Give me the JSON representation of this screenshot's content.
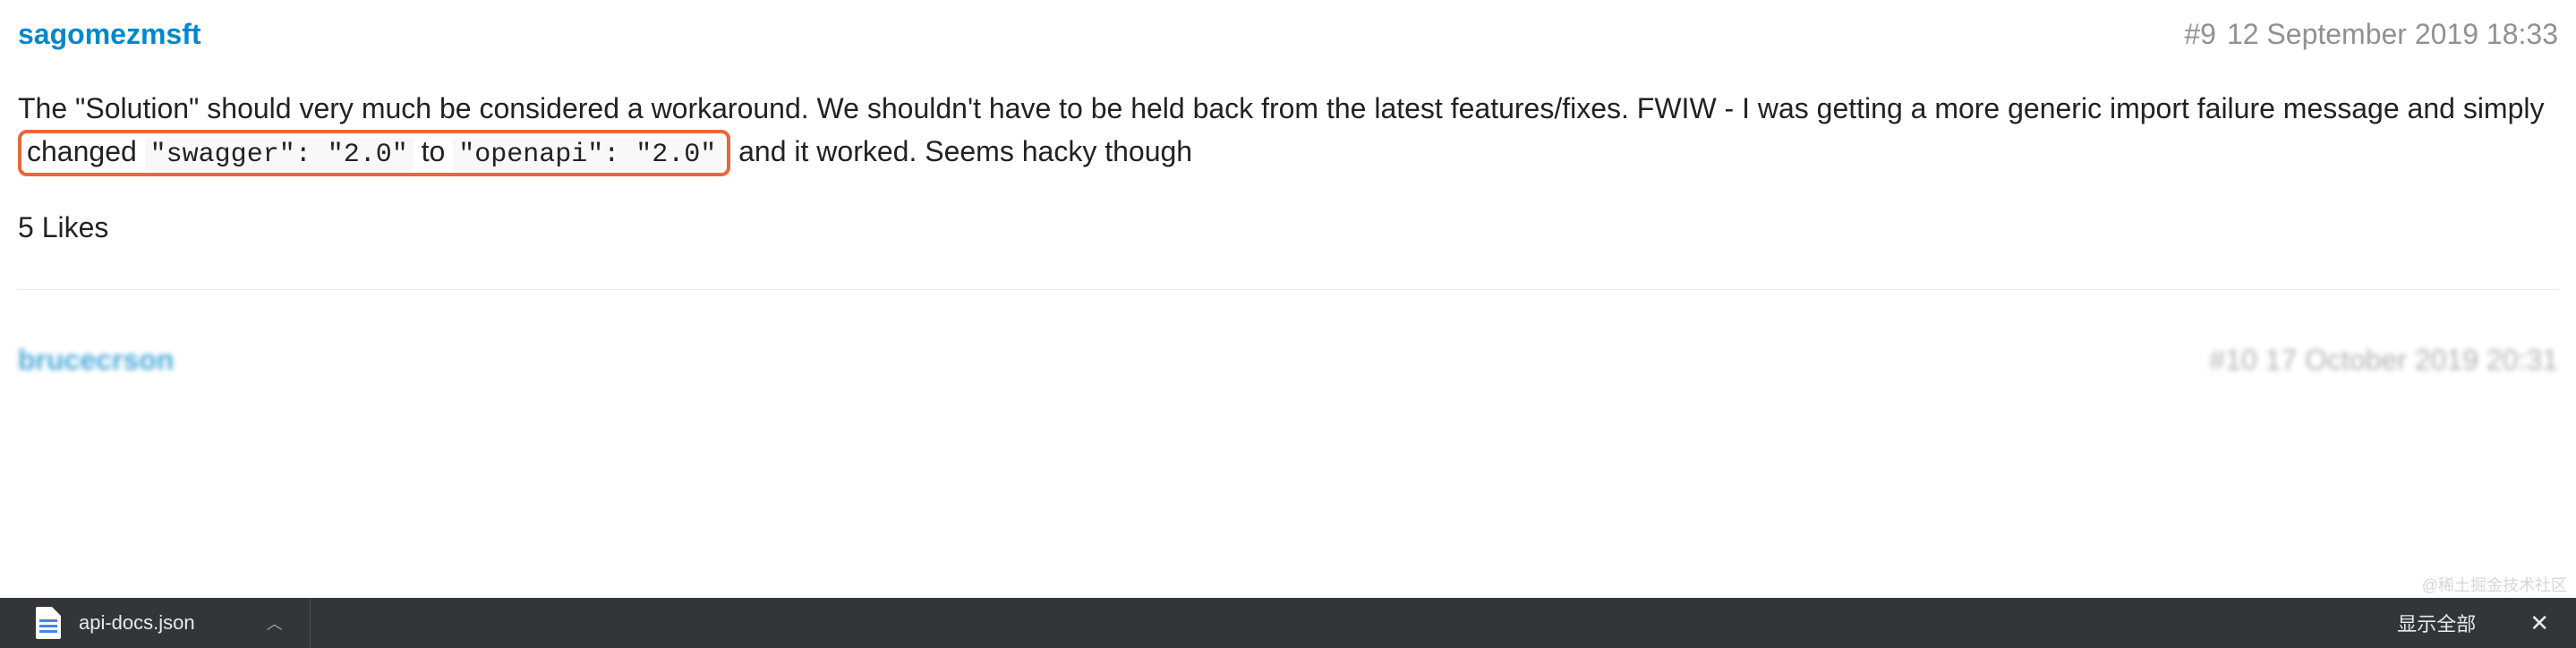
{
  "post": {
    "author": "sagomezmsft",
    "number": "#9",
    "date": "12 September 2019 18:33",
    "body_part1": "The \"Solution\" should very much be considered a workaround. We shouldn't have to be held back from the latest features/fixes. FWIW - I was getting a more generic import failure message and simply ",
    "highlight_prefix": "changed ",
    "code1": "\"swagger\": \"2.0\"",
    "highlight_mid": " to ",
    "code2": "\"openapi\": \"2.0\"",
    "body_part2": " and it worked. Seems hacky though",
    "likes": "5 Likes"
  },
  "next_post": {
    "author_hint": "brucecrson",
    "meta_hint": "#10 17 October 2019 20:31"
  },
  "download_bar": {
    "file_name": "api-docs.json",
    "show_all": "显示全部",
    "close": "✕"
  },
  "watermark": "@稀土掘金技术社区"
}
